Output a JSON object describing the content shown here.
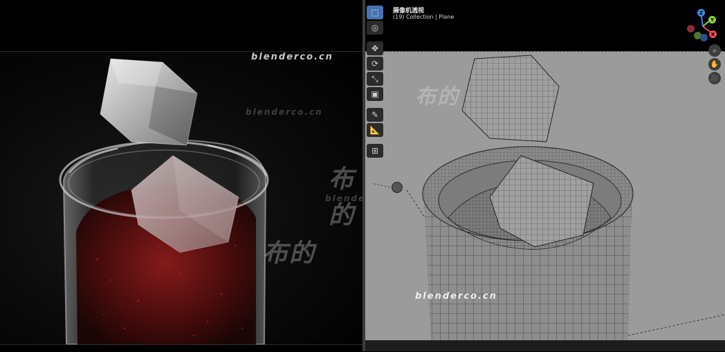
{
  "viewport": {
    "title": "摄像机透视",
    "subtitle": "(19) Collection | Plane"
  },
  "watermark": {
    "site": "blenderco.cn",
    "cn": "布的"
  },
  "gizmo": {
    "z": "Z",
    "y": "Y",
    "x": "X",
    "colors": {
      "x": "#e84b5a",
      "y": "#8ad13b",
      "z": "#3a8ee6",
      "neg_x": "#8d2b3a",
      "neg_y": "#4d7a2a",
      "neg_z": "#2c4f8c"
    }
  },
  "toolbar": {
    "tools": [
      "select-box",
      "cursor",
      "move",
      "rotate",
      "scale",
      "transform",
      "annotate",
      "measure",
      "add-cube"
    ]
  },
  "colors": {
    "accent": "#4772b3",
    "viewport_bg": "#9b9b9b",
    "liquid": "#7a1414"
  }
}
